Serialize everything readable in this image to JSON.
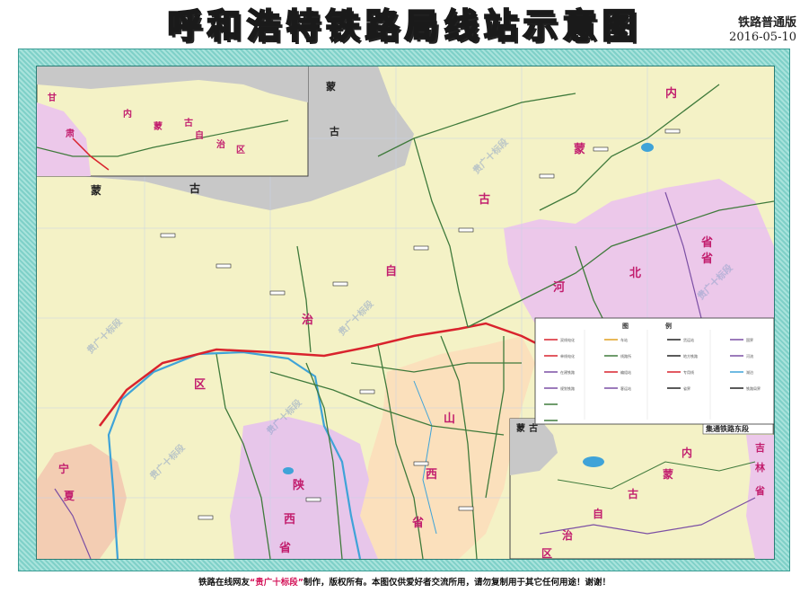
{
  "title": "呼和浩特铁路局线站示意图",
  "edition": "铁路普通版",
  "date": "2016-05-10",
  "footer": {
    "prefix": "铁路在线网友",
    "author": "“贵广十标段”",
    "suffix": "制作，版权所有。本图仅供爱好者交流所用，请勿复制用于其它任何用途！谢谢！"
  },
  "map": {
    "regions": {
      "mongolia_main": [
        "蒙",
        "古"
      ],
      "mongolia_upper": [
        "蒙",
        "古"
      ],
      "mongolia_inset": [
        "蒙",
        "古"
      ],
      "inner_mongolia": [
        "内",
        "蒙",
        "古",
        "自",
        "治",
        "区"
      ],
      "inset_nw": [
        "甘",
        "肃",
        "内",
        "蒙",
        "古",
        "自",
        "治",
        "区"
      ],
      "hebei": [
        "河",
        "北",
        "省"
      ],
      "shanxi": [
        "山",
        "西",
        "省"
      ],
      "shaanxi": [
        "陕",
        "西",
        "省"
      ],
      "ningxia": [
        "宁",
        "夏"
      ],
      "jilin": [
        "吉",
        "林",
        "省"
      ],
      "inset_se": [
        "内",
        "蒙",
        "古",
        "自",
        "治",
        "区"
      ]
    },
    "watermark": "贵广十标段",
    "legend": {
      "title": [
        "图",
        "例"
      ],
      "items": [
        "双线电化",
        "单线电化",
        "在建铁路",
        "规划铁路",
        "车站",
        "线路所",
        "编组站",
        "客运站",
        "货运站",
        "地方铁路",
        "专用线",
        "省界",
        "国界",
        "河流",
        "湖泊",
        "铁路局界"
      ]
    },
    "inset_se_title": "集通铁路东段"
  },
  "colors": {
    "frame": "#7fd0c8",
    "inner_mongolia": "#f4f2c6",
    "hebei": "#ecc8ea",
    "shanxi": "#fbe0bc",
    "shaanxi": "#e7c6ea",
    "ningxia": "#f3cdb3",
    "mongolia": "#c8c8c8",
    "railway_main": "#d9232d",
    "railway_other": "#3f7a3b",
    "river": "#3fa3d8",
    "label": "#c21e6e"
  }
}
